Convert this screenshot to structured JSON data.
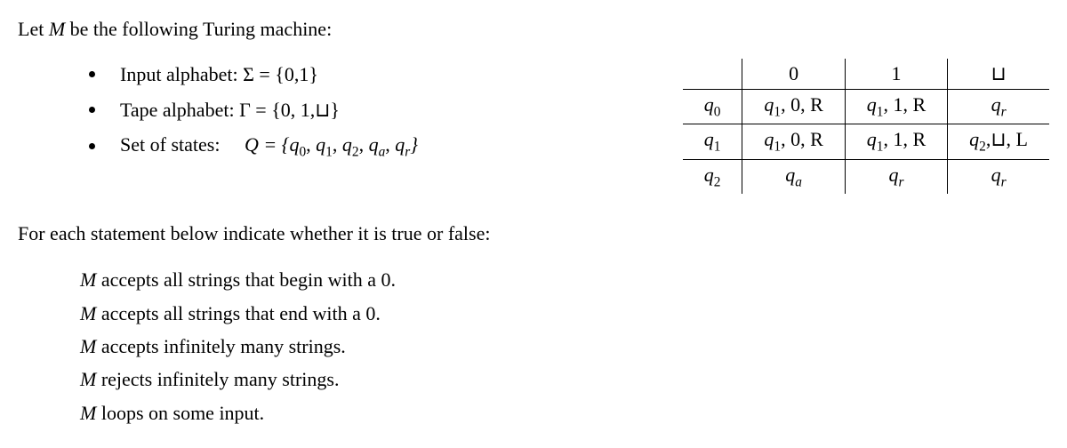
{
  "intro_prefix": "Let ",
  "intro_M": "M",
  "intro_suffix": " be the following Turing machine:",
  "bullets": {
    "input_alphabet": "Input alphabet: Σ = {0,1}",
    "tape_alphabet_prefix": "Tape alphabet:  Γ = {0, 1,",
    "tape_alphabet_suffix": "}",
    "states_label": "Set of states:",
    "states_val_prefix": "Q = {",
    "states_val_suffix": "}"
  },
  "table": {
    "headers": {
      "c0": "0",
      "c1": "1",
      "blank": "⊔"
    },
    "row0": {
      "state_num": "0",
      "c0": ", 0, R",
      "c0_state_num": "1",
      "c1": ", 1, R",
      "c1_state_num": "1",
      "cb_state_letter": "r"
    },
    "row1": {
      "state_num": "1",
      "c0": ", 0, R",
      "c0_state_num": "1",
      "c1": ", 1, R",
      "c1_state_num": "1",
      "cb_prefix": ",",
      "cb_suffix": ", L",
      "cb_state_num": "2"
    },
    "row2": {
      "state_num": "2",
      "c0_state_letter": "a",
      "c1_state_letter": "r",
      "cb_state_letter": "r"
    }
  },
  "instruction": "For each statement below indicate whether it is true or false:",
  "statements": {
    "s1_suffix": " accepts all strings that begin with a 0.",
    "s2_suffix": " accepts all strings that end with a 0.",
    "s3_suffix": " accepts infinitely many strings.",
    "s4_suffix": " rejects infinitely many strings.",
    "s5_suffix": " loops on some input."
  },
  "sym": {
    "q": "q",
    "blank": "⊔",
    "M": "M"
  }
}
